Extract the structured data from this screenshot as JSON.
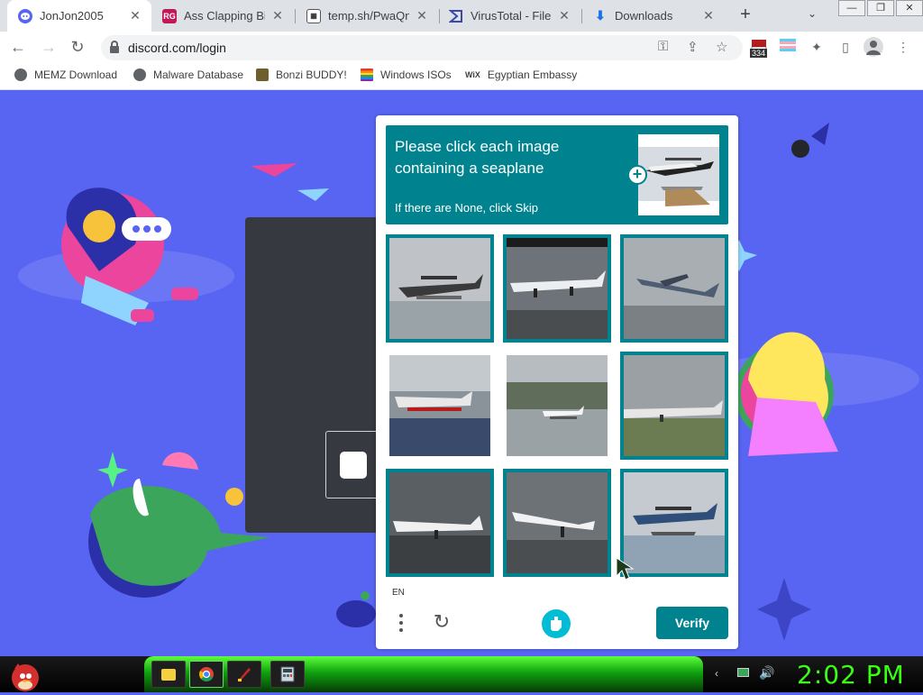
{
  "browser": {
    "tabs": [
      {
        "title": "JonJon2005",
        "favicon": "discord-icon",
        "active": true
      },
      {
        "title": "Ass Clapping Big",
        "favicon": "rg-icon",
        "active": false
      },
      {
        "title": "temp.sh/PwaQn/I",
        "favicon": "tempsh-icon",
        "active": false
      },
      {
        "title": "VirusTotal - File -",
        "favicon": "virustotal-icon",
        "active": false
      },
      {
        "title": "Downloads",
        "favicon": "download-icon",
        "active": false
      }
    ],
    "url": "discord.com/login",
    "extension_badge": "334",
    "bookmarks": [
      {
        "label": "MEMZ Download"
      },
      {
        "label": "Malware Database"
      },
      {
        "label": "Bonzi BUDDY!"
      },
      {
        "label": "Windows ISOs"
      },
      {
        "label": "Egyptian Embassy",
        "prefix": "WiX"
      }
    ]
  },
  "captcha": {
    "prompt": "Please click each image containing a seaplane",
    "hint": "If there are None, click Skip",
    "language": "EN",
    "verify_label": "Verify",
    "tiles": [
      {
        "name": "tile-1",
        "selected": true
      },
      {
        "name": "tile-2",
        "selected": true
      },
      {
        "name": "tile-3",
        "selected": true
      },
      {
        "name": "tile-4",
        "selected": false
      },
      {
        "name": "tile-5",
        "selected": false
      },
      {
        "name": "tile-6",
        "selected": true
      },
      {
        "name": "tile-7",
        "selected": true
      },
      {
        "name": "tile-8",
        "selected": true
      },
      {
        "name": "tile-9",
        "selected": true
      }
    ]
  },
  "taskbar": {
    "clock": "2:02 PM",
    "apps": [
      "explorer-icon",
      "chrome-icon",
      "paint-icon",
      "calculator-icon"
    ]
  },
  "colors": {
    "discord_blurple": "#5865f2",
    "captcha_teal": "#00838f",
    "clock_green": "#39ff14"
  }
}
